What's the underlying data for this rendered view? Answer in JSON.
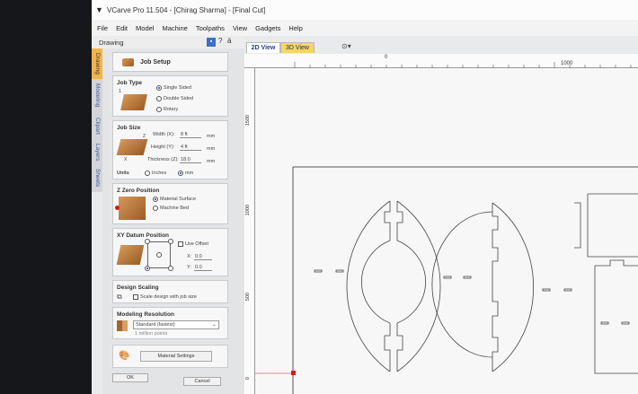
{
  "app": {
    "title": "VCarve Pro 11.504 - [Chirag Sharma] - [Final Cut]"
  },
  "menu": [
    "File",
    "Edit",
    "Model",
    "Machine",
    "Toolpaths",
    "View",
    "Gadgets",
    "Help"
  ],
  "panel_header": {
    "title": "Drawing",
    "help": "?",
    "close": "ä"
  },
  "side_tabs": [
    "Drawing",
    "Modeling",
    "Clipart",
    "Layers",
    "Sheets"
  ],
  "job_setup": {
    "title": "Job Setup",
    "job_type": {
      "heading": "Job Type",
      "number": "1",
      "options": [
        "Single Sided",
        "Double Sided",
        "Rotary"
      ],
      "selected": "Single Sided"
    },
    "job_size": {
      "heading": "Job Size",
      "width_label": "Width (X):",
      "width_value": "8 ft",
      "height_label": "Height (Y):",
      "height_value": "4 ft",
      "thickness_label": "Thickness (Z):",
      "thickness_value": "18.0",
      "unit_mm": "mm",
      "units_label": "Units",
      "units_options": [
        "Inches",
        "mm"
      ],
      "units_selected": "mm"
    },
    "z_zero": {
      "heading": "Z Zero Position",
      "options": [
        "Material Surface",
        "Machine Bed"
      ],
      "selected": "Material Surface"
    },
    "xy_datum": {
      "heading": "XY Datum Position",
      "use_offset_label": "Use Offset",
      "x_label": "X:",
      "x_value": "0.0",
      "y_label": "Y:",
      "y_value": "0.0"
    },
    "design_scaling": {
      "heading": "Design Scaling",
      "checkbox_label": "Scale design with job size"
    },
    "modeling_resolution": {
      "heading": "Modeling Resolution",
      "selected": "Standard (fastest)",
      "note": "1 million points"
    },
    "material_settings_label": "Material Settings",
    "ok_label": "OK",
    "cancel_label": "Cancel"
  },
  "view_tabs": [
    "2D View",
    "3D View"
  ],
  "rulers": {
    "top": [
      "0",
      "1000"
    ],
    "left": [
      "1500",
      "1000",
      "500",
      "0"
    ]
  },
  "colors": {
    "accent_tab": "#f2b44a",
    "highlight_blue": "#3f6fc5",
    "origin_marker": "#e2141c"
  }
}
